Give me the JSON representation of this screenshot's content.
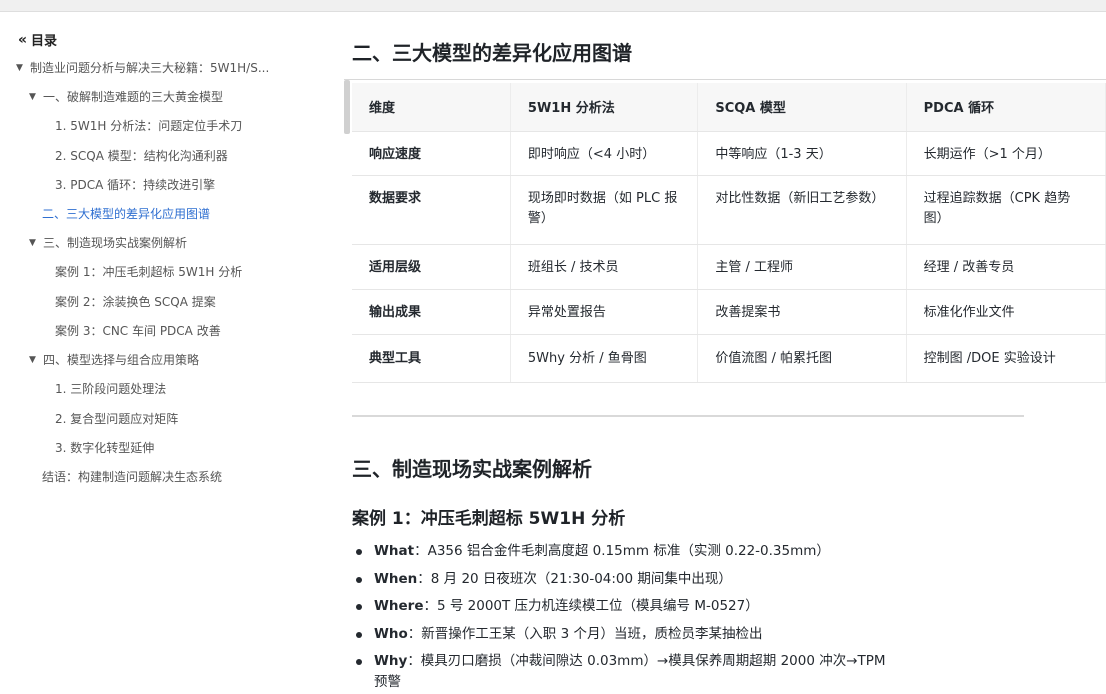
{
  "toc": {
    "title": "目录",
    "items": [
      {
        "label": "制造业问题分析与解决三大秘籍：5W1H/S...",
        "caret": "▼"
      },
      {
        "label": "一、破解制造难题的三大黄金模型",
        "caret": "▼"
      },
      {
        "label": "1. 5W1H 分析法：问题定位手术刀"
      },
      {
        "label": "2. SCQA 模型：结构化沟通利器"
      },
      {
        "label": "3. PDCA 循环：持续改进引擎"
      },
      {
        "label": "二、三大模型的差异化应用图谱",
        "active": true
      },
      {
        "label": "三、制造现场实战案例解析",
        "caret": "▼"
      },
      {
        "label": "案例 1：冲压毛刺超标 5W1H 分析"
      },
      {
        "label": "案例 2：涂装换色 SCQA 提案"
      },
      {
        "label": "案例 3：CNC 车间 PDCA 改善"
      },
      {
        "label": "四、模型选择与组合应用策略",
        "caret": "▼"
      },
      {
        "label": "1. 三阶段问题处理法"
      },
      {
        "label": "2. 复合型问题应对矩阵"
      },
      {
        "label": "3. 数字化转型延伸"
      },
      {
        "label": "结语：构建制造问题解决生态系统"
      }
    ]
  },
  "section2": {
    "title": "二、三大模型的差异化应用图谱",
    "table": {
      "headers": [
        "维度",
        "5W1H 分析法",
        "SCQA 模型",
        "PDCA 循环"
      ],
      "rows": [
        [
          "响应速度",
          "即时响应（<4 小时）",
          "中等响应（1-3 天）",
          "长期运作（>1 个月）"
        ],
        [
          "数据要求",
          "现场即时数据（如 PLC 报警）",
          "对比性数据（新旧工艺参数）",
          "过程追踪数据（CPK 趋势图）"
        ],
        [
          "适用层级",
          "班组长 / 技术员",
          "主管 / 工程师",
          "经理 / 改善专员"
        ],
        [
          "输出成果",
          "异常处置报告",
          "改善提案书",
          "标准化作业文件"
        ],
        [
          "典型工具",
          "5Why 分析 / 鱼骨图",
          "价值流图 / 帕累托图",
          "控制图 /DOE 实验设计"
        ]
      ]
    }
  },
  "section3": {
    "title": "三、制造现场实战案例解析",
    "case1": {
      "title": "案例 1：冲压毛刺超标 5W1H 分析",
      "bullets": [
        {
          "key": "What",
          "text": "：A356 铝合金件毛刺高度超 0.15mm 标准（实测 0.22-0.35mm）"
        },
        {
          "key": "When",
          "text": "：8 月 20 日夜班次（21:30-04:00 期间集中出现）"
        },
        {
          "key": "Where",
          "text": "：5 号 2000T 压力机连续模工位（模具编号 M-0527）"
        },
        {
          "key": "Who",
          "text": "：新晋操作工王某（入职 3 个月）当班，质检员李某抽检出"
        },
        {
          "key": "Why",
          "text": "：模具刃口磨损（冲裁间隙达 0.03mm）→模具保养周期超期 2000 冲次→TPM",
          "text2": "预警"
        }
      ]
    }
  }
}
